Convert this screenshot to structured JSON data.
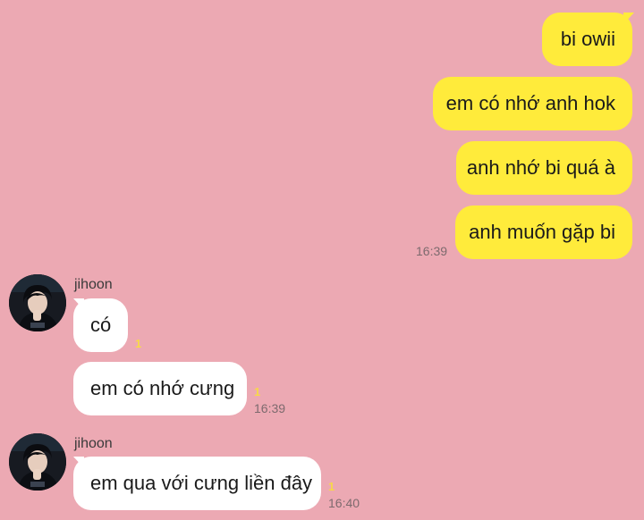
{
  "messages": {
    "sent": [
      {
        "text": "bi owii"
      },
      {
        "text": "em có nhớ anh hok"
      },
      {
        "text": "anh nhớ bi quá à"
      },
      {
        "text": "anh muốn gặp bi",
        "time": "16:39"
      }
    ],
    "received_group1": {
      "sender": "jihoon",
      "messages": [
        {
          "text": "có",
          "unread": "1"
        },
        {
          "text": "em có nhớ cưng",
          "unread": "1",
          "time": "16:39"
        }
      ]
    },
    "received_group2": {
      "sender": "jihoon",
      "messages": [
        {
          "text": "em qua với cưng liền đây",
          "unread": "1",
          "time": "16:40"
        }
      ]
    }
  },
  "colors": {
    "background": "#eca9b3",
    "sent_bubble": "#ffeb3b",
    "received_bubble": "#ffffff",
    "unread_count": "#f7d84a"
  },
  "icons": {
    "avatar": "profile-photo"
  }
}
